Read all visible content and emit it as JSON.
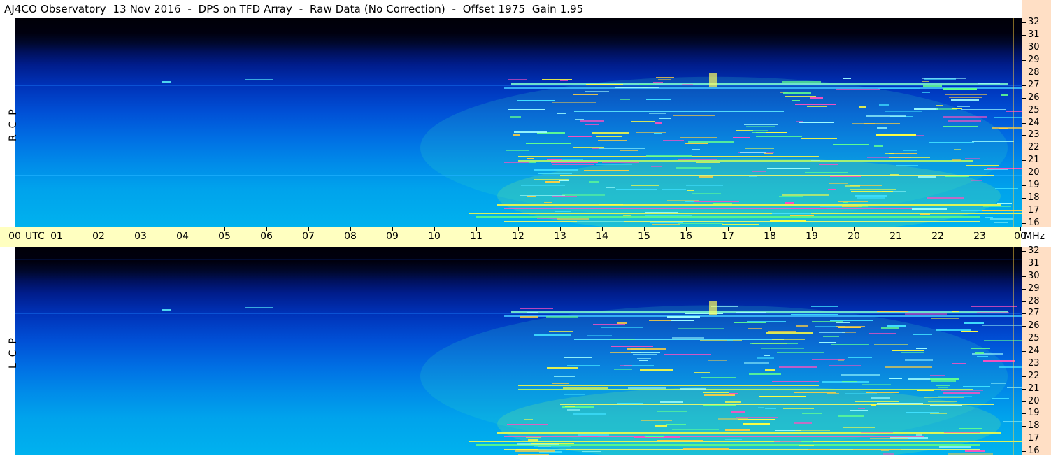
{
  "header": {
    "title": "AJ4CO Observatory  13 Nov 2016  -  DPS on TFD Array  -  Raw Data (No Correction)  -  Offset 1975  Gain 1.95"
  },
  "panels": {
    "rcp": {
      "label": "R  C  P"
    },
    "lcp": {
      "label": "L  C  P"
    }
  },
  "time_axis": {
    "start_label": "00",
    "unit_label": "UTC",
    "hour_labels": [
      "01",
      "02",
      "03",
      "04",
      "05",
      "06",
      "07",
      "08",
      "09",
      "10",
      "11",
      "12",
      "13",
      "14",
      "15",
      "16",
      "17",
      "18",
      "19",
      "20",
      "21",
      "22",
      "23"
    ],
    "end_label": "00",
    "freq_unit": "MHz"
  },
  "freq_axis": {
    "labels": [
      "32",
      "31",
      "30",
      "29",
      "28",
      "27",
      "26",
      "25",
      "24",
      "23",
      "22",
      "21",
      "20",
      "19",
      "18",
      "17",
      "16"
    ]
  },
  "colors": {
    "time_axis_bg": "#ffffc0",
    "freq_axis_bg": "#ffdfc5",
    "colormap": [
      "#000008",
      "#0032b8",
      "#00a3ec",
      "#40e0a0",
      "#ffff40",
      "#ff40c0"
    ]
  }
}
